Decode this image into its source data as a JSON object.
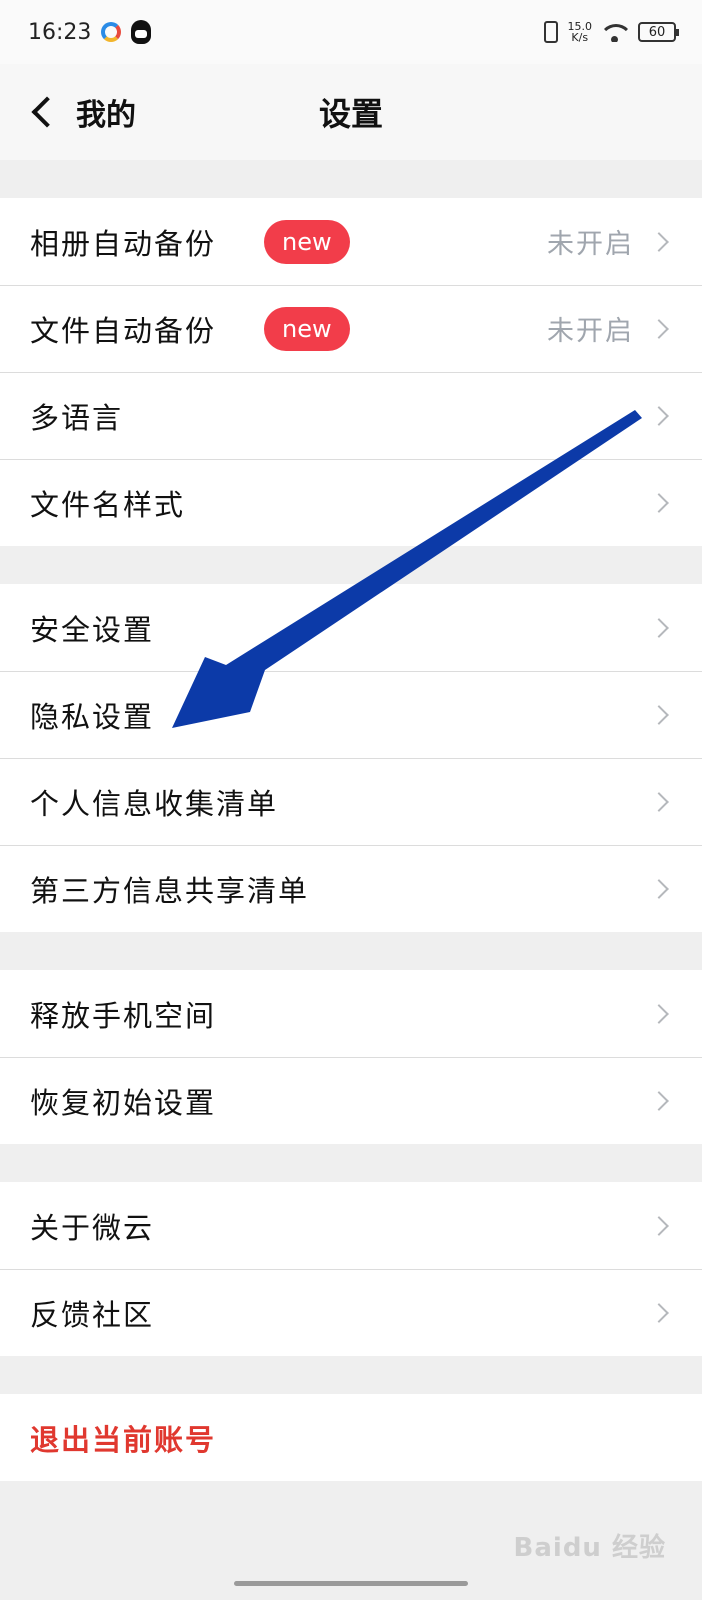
{
  "status_bar": {
    "time": "16:23",
    "speed_value": "15.0",
    "speed_unit": "K/s",
    "battery": "60"
  },
  "nav": {
    "back_label": "我的",
    "title": "设置"
  },
  "groups": [
    [
      {
        "label": "相册自动备份",
        "badge": "new",
        "value": "未开启"
      },
      {
        "label": "文件自动备份",
        "badge": "new",
        "value": "未开启"
      },
      {
        "label": "多语言"
      },
      {
        "label": "文件名样式"
      }
    ],
    [
      {
        "label": "安全设置"
      },
      {
        "label": "隐私设置"
      },
      {
        "label": "个人信息收集清单"
      },
      {
        "label": "第三方信息共享清单"
      }
    ],
    [
      {
        "label": "释放手机空间"
      },
      {
        "label": "恢复初始设置"
      }
    ],
    [
      {
        "label": "关于微云"
      },
      {
        "label": "反馈社区"
      }
    ]
  ],
  "logout_label": "退出当前账号",
  "watermark": "Baidu 经验",
  "colors": {
    "badge": "#f23d4a",
    "logout": "#e0382f",
    "arrow": "#0c3aa8"
  }
}
